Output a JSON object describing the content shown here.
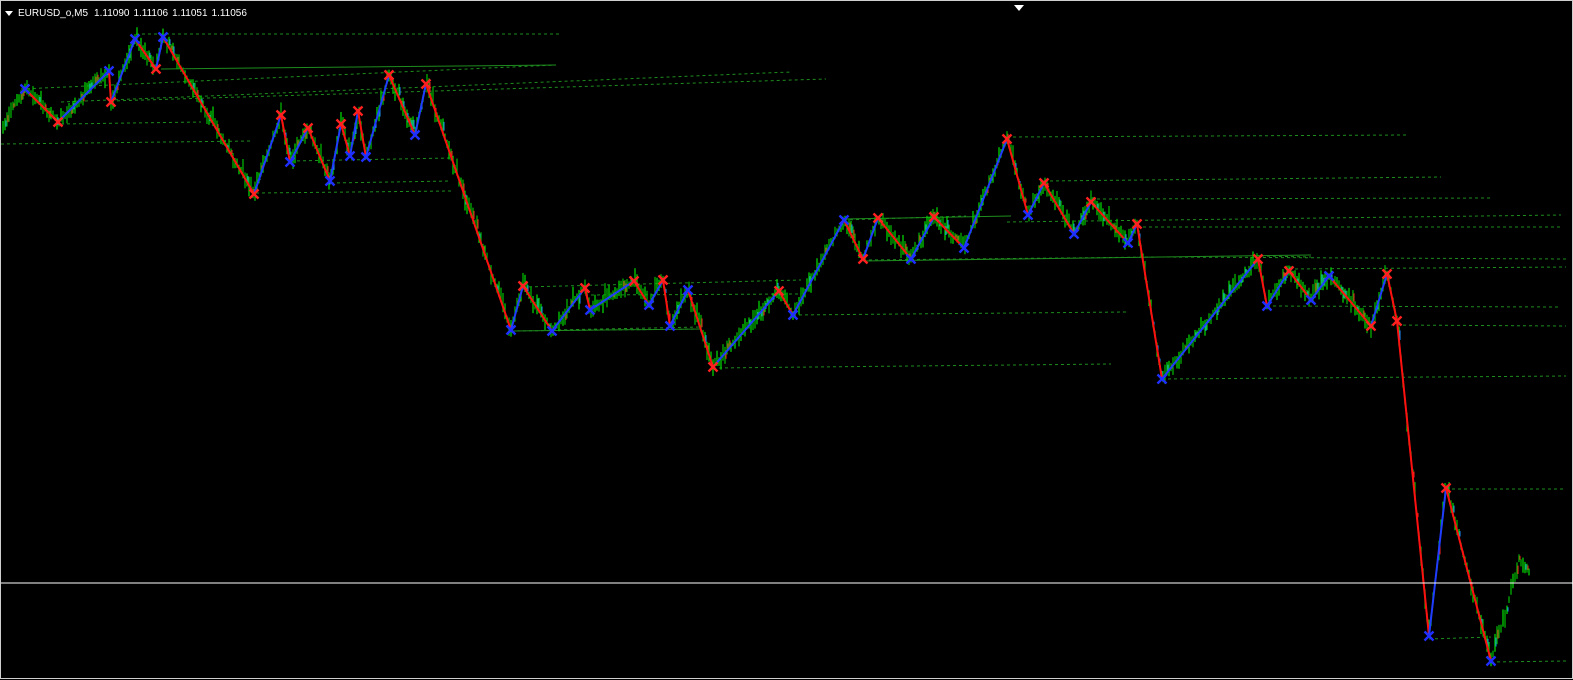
{
  "header": {
    "symbol": "EURUSD_o,M5",
    "open": "1.11090",
    "high": "1.11106",
    "low": "1.11051",
    "close": "1.11056"
  },
  "colors": {
    "background": "#000000",
    "bull_candle": "#00d000",
    "bear_candle": "#00b000",
    "bull_accent": "#1e90ff",
    "bear_accent": "#ff2020",
    "zigzag_up": "#1f3cff",
    "zigzag_down": "#ff1010",
    "peak_marker": "#1f2fff",
    "trough_marker": "#ff2020",
    "level_line": "#1e8c1e",
    "bid_line": "#ffffff"
  },
  "chart_data": {
    "type": "candlestick",
    "symbol": "EURUSD_o",
    "timeframe": "M5",
    "indicator": "zigzag with swing markers and support/resistance levels",
    "swing_points": [
      {
        "bar": 6,
        "kind": "peak"
      },
      {
        "bar": 15,
        "kind": "trough"
      },
      {
        "bar": 27,
        "kind": "peak"
      },
      {
        "bar": 28,
        "kind": "trough"
      },
      {
        "bar": 33,
        "kind": "peak"
      },
      {
        "bar": 39,
        "kind": "trough"
      },
      {
        "bar": 40,
        "kind": "peak"
      },
      {
        "bar": 54,
        "kind": "trough"
      },
      {
        "bar": 63,
        "kind": "trough"
      },
      {
        "bar": 70,
        "kind": "peak"
      },
      {
        "bar": 73,
        "kind": "trough"
      },
      {
        "bar": 77,
        "kind": "peak"
      },
      {
        "bar": 83,
        "kind": "trough"
      },
      {
        "bar": 85,
        "kind": "peak"
      },
      {
        "bar": 88,
        "kind": "trough"
      },
      {
        "bar": 90,
        "kind": "peak"
      },
      {
        "bar": 92,
        "kind": "trough"
      },
      {
        "bar": 97,
        "kind": "peak"
      },
      {
        "bar": 102,
        "kind": "trough"
      },
      {
        "bar": 106,
        "kind": "peak"
      },
      {
        "bar": 127,
        "kind": "trough"
      },
      {
        "bar": 131,
        "kind": "peak"
      },
      {
        "bar": 137,
        "kind": "trough"
      },
      {
        "bar": 146,
        "kind": "peak"
      },
      {
        "bar": 148,
        "kind": "trough"
      },
      {
        "bar": 158,
        "kind": "peak"
      },
      {
        "bar": 162,
        "kind": "trough"
      },
      {
        "bar": 165,
        "kind": "peak"
      },
      {
        "bar": 172,
        "kind": "peak"
      },
      {
        "bar": 178,
        "kind": "trough"
      },
      {
        "bar": 194,
        "kind": "trough"
      },
      {
        "bar": 198,
        "kind": "peak"
      },
      {
        "bar": 215,
        "kind": "peak"
      },
      {
        "bar": 218,
        "kind": "trough"
      },
      {
        "bar": 227,
        "kind": "trough"
      },
      {
        "bar": 234,
        "kind": "peak"
      },
      {
        "bar": 240,
        "kind": "trough"
      },
      {
        "bar": 251,
        "kind": "peak"
      },
      {
        "bar": 256,
        "kind": "trough"
      },
      {
        "bar": 260,
        "kind": "peak"
      },
      {
        "bar": 268,
        "kind": "trough"
      },
      {
        "bar": 272,
        "kind": "peak"
      },
      {
        "bar": 278,
        "kind": "trough"
      },
      {
        "bar": 284,
        "kind": "peak"
      },
      {
        "bar": 291,
        "kind": "trough"
      },
      {
        "bar": 314,
        "kind": "peak"
      },
      {
        "bar": 320,
        "kind": "trough"
      },
      {
        "bar": 322,
        "kind": "peak"
      },
      {
        "bar": 334,
        "kind": "trough"
      },
      {
        "bar": 346,
        "kind": "peak"
      },
      {
        "bar": 360,
        "kind": "peak"
      },
      {
        "bar": 361,
        "kind": "trough"
      },
      {
        "bar": 372,
        "kind": "trough"
      }
    ],
    "bid_price": "1.11056"
  }
}
